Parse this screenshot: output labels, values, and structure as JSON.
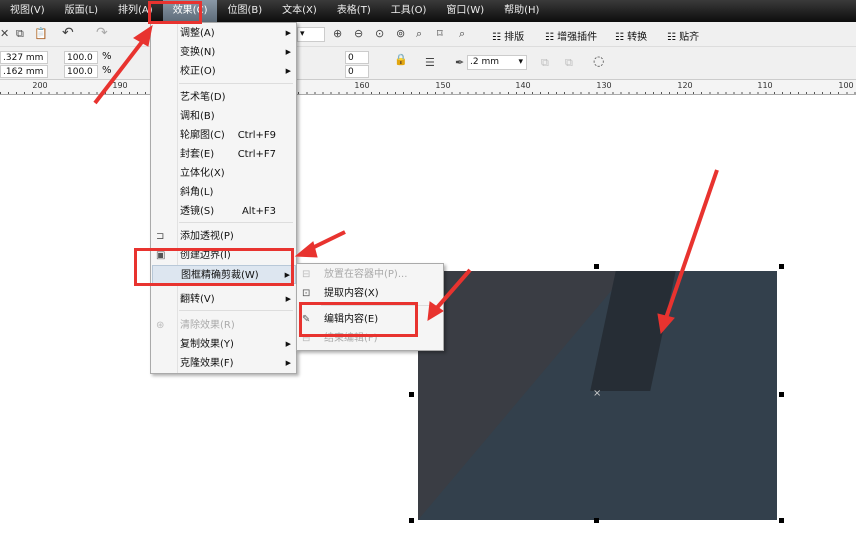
{
  "menubar": [
    "视图(V)",
    "版面(L)",
    "排列(A)",
    "效果(C)",
    "位图(B)",
    "文本(X)",
    "表格(T)",
    "工具(O)",
    "窗口(W)",
    "帮助(H)"
  ],
  "toolbar1": {
    "zoom_select": "",
    "buttons": [
      "排版",
      "增强插件",
      "转换",
      "贴齐"
    ]
  },
  "toolbar2": {
    "x_value": ".327 mm",
    "y_value": ".162 mm",
    "scale_x": "100.0",
    "scale_y": "100.0",
    "pct": "%",
    "n1": "0",
    "n2": "0",
    "outline_width": ".2 mm"
  },
  "ruler": [
    "200",
    "190",
    "160",
    "150",
    "140",
    "130",
    "120",
    "110",
    "100"
  ],
  "effects_menu": [
    {
      "label": "调整(A)",
      "arrow": true
    },
    {
      "label": "变换(N)",
      "arrow": true
    },
    {
      "label": "校正(O)",
      "arrow": true
    },
    {
      "label": "艺术笔(D)"
    },
    {
      "label": "调和(B)"
    },
    {
      "label": "轮廓图(C)",
      "shortcut": "Ctrl+F9"
    },
    {
      "label": "封套(E)",
      "shortcut": "Ctrl+F7"
    },
    {
      "label": "立体化(X)"
    },
    {
      "label": "斜角(L)"
    },
    {
      "label": "透镜(S)",
      "shortcut": "Alt+F3"
    },
    {
      "label": "添加透视(P)"
    },
    {
      "label": "创建边界(I)"
    },
    {
      "label": "图框精确剪裁(W)",
      "arrow": true
    },
    {
      "label": "翻转(V)",
      "arrow": true
    },
    {
      "label": "清除效果(R)",
      "disabled": true
    },
    {
      "label": "复制效果(Y)",
      "arrow": true
    },
    {
      "label": "克隆效果(F)",
      "arrow": true
    }
  ],
  "powerclip_submenu": [
    {
      "label": "放置在容器中(P)...",
      "disabled": true
    },
    {
      "label": "提取内容(X)"
    },
    {
      "label": "编辑内容(E)"
    },
    {
      "label": "结束编辑(F)",
      "disabled": true
    }
  ],
  "colors": {
    "highlight": "#e8332f",
    "image": "#33404c"
  }
}
